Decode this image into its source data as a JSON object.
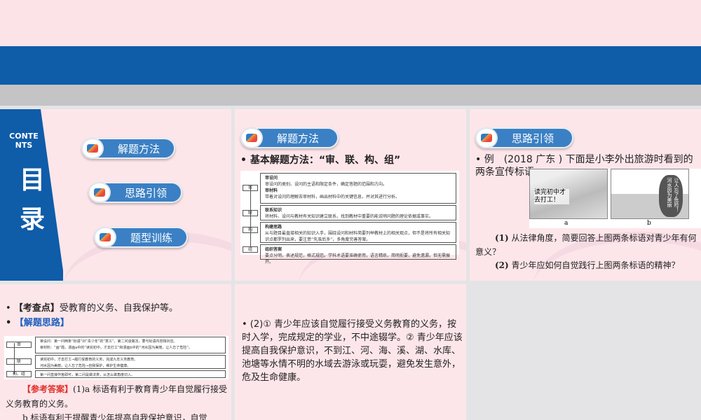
{
  "toc": {
    "en": "CONTENTS",
    "en1": "CONTE",
    "en2": "NTS",
    "cn1": "目",
    "cn2": "录",
    "items": [
      "解题方法",
      "思路引领",
      "题型训练"
    ]
  },
  "slide2": {
    "header": "解题方法",
    "bullet": "• 基本解题方法：“审、联、构、组”",
    "rows": [
      {
        "label": "审",
        "lines": [
          "审设问",
          "审设问的类别、设问的主语和限定条件，确定答题的范围和方向。",
          "审材料",
          "带着对设问的理解去审材料，画出材料中的关键信息，并对其进行分析。"
        ]
      },
      {
        "label": "联",
        "lines": [
          "联系知识",
          "将材料、设问与教材有关知识建立联系，找到教材中重要的能说明问题的理论依据或事实。"
        ]
      },
      {
        "label": "构",
        "lines": [
          "构建思路",
          "从与题目最直接相关的知识入手，围绕设问和材料简要列举教材上的相关观点，但不是将所有相关知识点都罗列出来，要注意“先准后多”，多角度完善答案。"
        ]
      },
      {
        "label": "组",
        "lines": [
          "组织答案",
          "要点分明，表述规范，格式规范。学科术语要准确使用，语言精练，简明扼要，避免遗漏，但无需展开。"
        ]
      }
    ]
  },
  "slide3": {
    "header": "思路引领",
    "example": "• 例　(2018 广东 ) 下面是小李外出旅游时看到的两条宣传标语",
    "pic_a_text": "读完初中才去打工！",
    "pic_a_label": "a",
    "pic_b_text": "让人忘了危险！河水因为美丽",
    "pic_b_label": "b",
    "q1_num": "(1)",
    "q1": "从法律角度，简要回答上图两条标语对青少年有何意义？",
    "q2_num": "(2)",
    "q2": "青少年应如何自觉践行上图两条标语的精神？"
  },
  "slide4": {
    "kaocha_label": "【考查点】",
    "kaocha": "受教育的义务、自我保护等。",
    "silu_label": "【解题思路】",
    "rows": [
      {
        "label": "审",
        "lines": [
          "审设问：第一问两条“标语”对“青少年”的“意义”。第二问谈做法，要与标语内容相对应。",
          "审材料：“画”题，漫画a中的“读完初中，才去打工”和漫画b中的“河水因为美丽，让人忘了危险”。"
        ]
      },
      {
        "label": "联",
        "lines": [
          "读完初中，才去打工→履行受教育的义务，完成九年义务教育。",
          "河水因为美丽，让人忘了危险→自我保护，维护生命健康。"
        ]
      },
      {
        "label": "构、组",
        "lines": [
          "第一问直接作答即可，第二问是做法类，从怎么做角度切入。"
        ]
      }
    ],
    "answer_label": "【参考答案】",
    "answer1": "(1)a 标语有利于教育青少年自觉履行接受义务教育的义务。",
    "answer2": "b 标语有利于提醒青少年提高自我保护意识，自觉"
  },
  "slide5": {
    "text": "• (2)① 青少年应该自觉履行接受义务教育的义务，按时入学，完成规定的学业，不中途辍学。② 青少年应该提高自我保护意识，不到江、河、海、溪、湖、水库、池塘等水情不明的水域去游泳或玩耍，避免发生意外，危及生命健康。"
  },
  "colors": {
    "blue": "#0f5ca9",
    "pink": "#fde6ea",
    "red": "#e0302a",
    "link": "#1f5fbf"
  }
}
